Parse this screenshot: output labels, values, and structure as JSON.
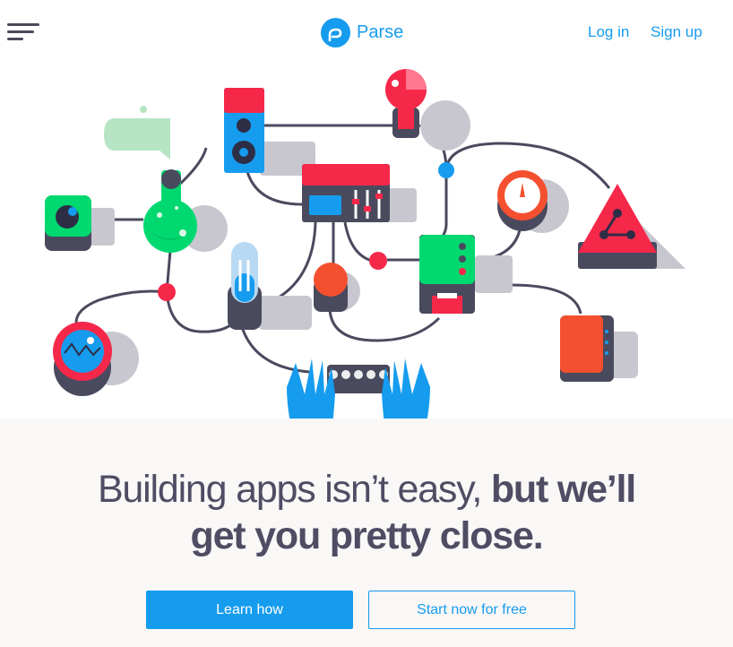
{
  "header": {
    "menu_icon": "hamburger-icon",
    "logo_icon": "parse-logo-icon",
    "logo_text": "Parse",
    "login_label": "Log in",
    "signup_label": "Sign up"
  },
  "hero": {
    "illustration": "connected-devices-illustration",
    "headline_regular": "Building apps isn’t easy,",
    "headline_bold_line1": "but we’ll",
    "headline_bold_line2": "get you pretty close."
  },
  "cta": {
    "primary_label": "Learn how",
    "secondary_label": "Start now for free"
  },
  "colors": {
    "brand": "#169cee",
    "text_dark": "#4e4d63",
    "red": "#f5284a",
    "green": "#00d970",
    "orange": "#f4502f"
  }
}
